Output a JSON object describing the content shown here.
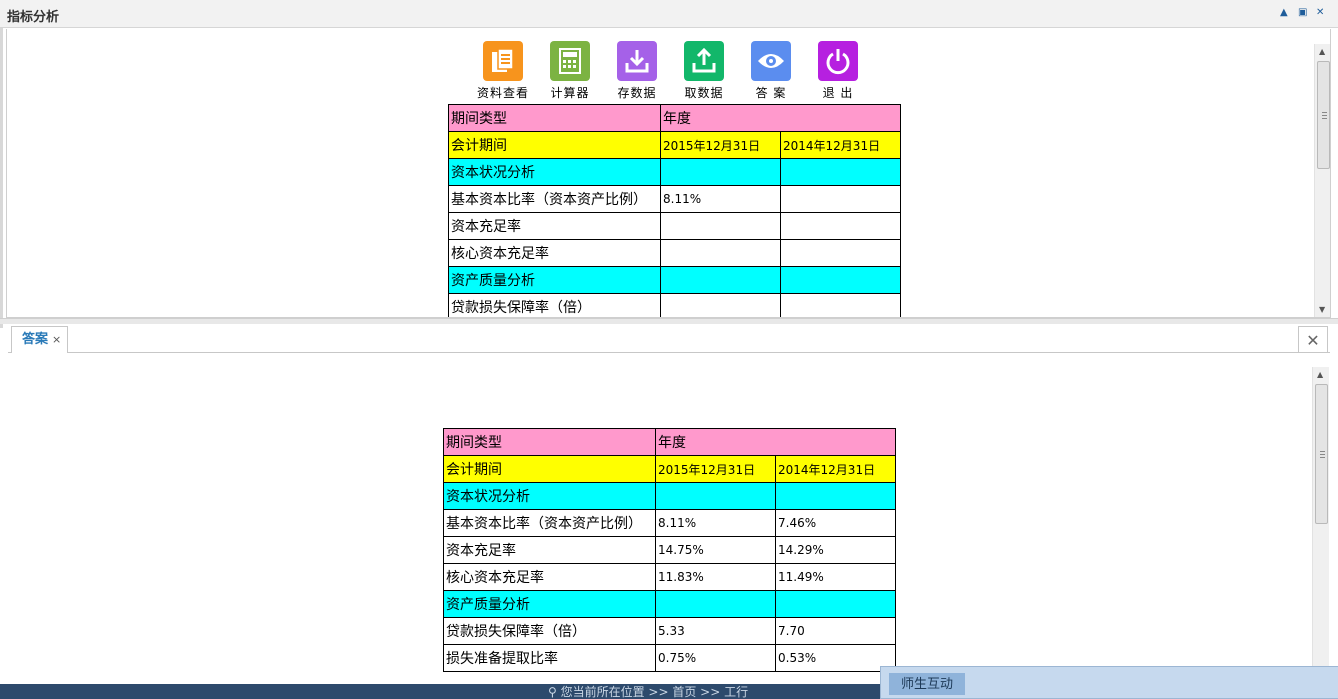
{
  "window": {
    "title": "指标分析",
    "controls": {
      "minimize": "▲",
      "maximize": "▣",
      "close": "✕"
    }
  },
  "toolbar": [
    {
      "icon": "document-icon",
      "label": "资料查看",
      "color": "#f7941d"
    },
    {
      "icon": "calculator-icon",
      "label": "计算器",
      "color": "#7cb342"
    },
    {
      "icon": "download-icon",
      "label": "存数据",
      "color": "#a561e8"
    },
    {
      "icon": "upload-icon",
      "label": "取数据",
      "color": "#12b76a"
    },
    {
      "icon": "eye-icon",
      "label": "答 案",
      "color": "#5b8def"
    },
    {
      "icon": "power-icon",
      "label": "退 出",
      "color": "#b620e0"
    }
  ],
  "colors": {
    "pink": "#ff99cc",
    "yellow": "#ffff00",
    "cyan": "#00ffff"
  },
  "upper_table": {
    "rows": [
      {
        "style": "pink",
        "cells": [
          "期间类型",
          "年度"
        ]
      },
      {
        "style": "yel",
        "cells": [
          "会计期间",
          "2015年12月31日",
          "2014年12月31日"
        ]
      },
      {
        "style": "cyan",
        "cells": [
          "资本状况分析",
          "",
          ""
        ]
      },
      {
        "style": "",
        "cells": [
          "基本资本比率（资本资产比例）",
          "8.11%",
          ""
        ]
      },
      {
        "style": "",
        "cells": [
          "资本充足率",
          "",
          ""
        ]
      },
      {
        "style": "",
        "cells": [
          "核心资本充足率",
          "",
          ""
        ]
      },
      {
        "style": "cyan",
        "cells": [
          "资产质量分析",
          "",
          ""
        ]
      },
      {
        "style": "",
        "cells": [
          "贷款损失保障率（倍）",
          "",
          ""
        ]
      }
    ]
  },
  "answer_tab": {
    "label": "答案",
    "close": "×"
  },
  "pane_close": "✕",
  "lower_table": {
    "rows": [
      {
        "style": "pink",
        "cells": [
          "期间类型",
          "年度"
        ]
      },
      {
        "style": "yel",
        "cells": [
          "会计期间",
          "2015年12月31日",
          "2014年12月31日"
        ]
      },
      {
        "style": "cyan",
        "cells": [
          "资本状况分析",
          "",
          ""
        ]
      },
      {
        "style": "",
        "cells": [
          "基本资本比率（资本资产比例）",
          "8.11%",
          "7.46%"
        ]
      },
      {
        "style": "",
        "cells": [
          "资本充足率",
          "14.75%",
          "14.29%"
        ]
      },
      {
        "style": "",
        "cells": [
          "核心资本充足率",
          "11.83%",
          "11.49%"
        ]
      },
      {
        "style": "cyan",
        "cells": [
          "资产质量分析",
          "",
          ""
        ]
      },
      {
        "style": "",
        "cells": [
          "贷款损失保障率（倍）",
          "5.33",
          "7.70"
        ]
      },
      {
        "style": "",
        "cells": [
          "损失准备提取比率",
          "0.75%",
          "0.53%"
        ]
      }
    ]
  },
  "status": {
    "location": "您当前所在位置  >>  首页  >>  工行"
  },
  "interaction": {
    "label": "师生互动"
  }
}
